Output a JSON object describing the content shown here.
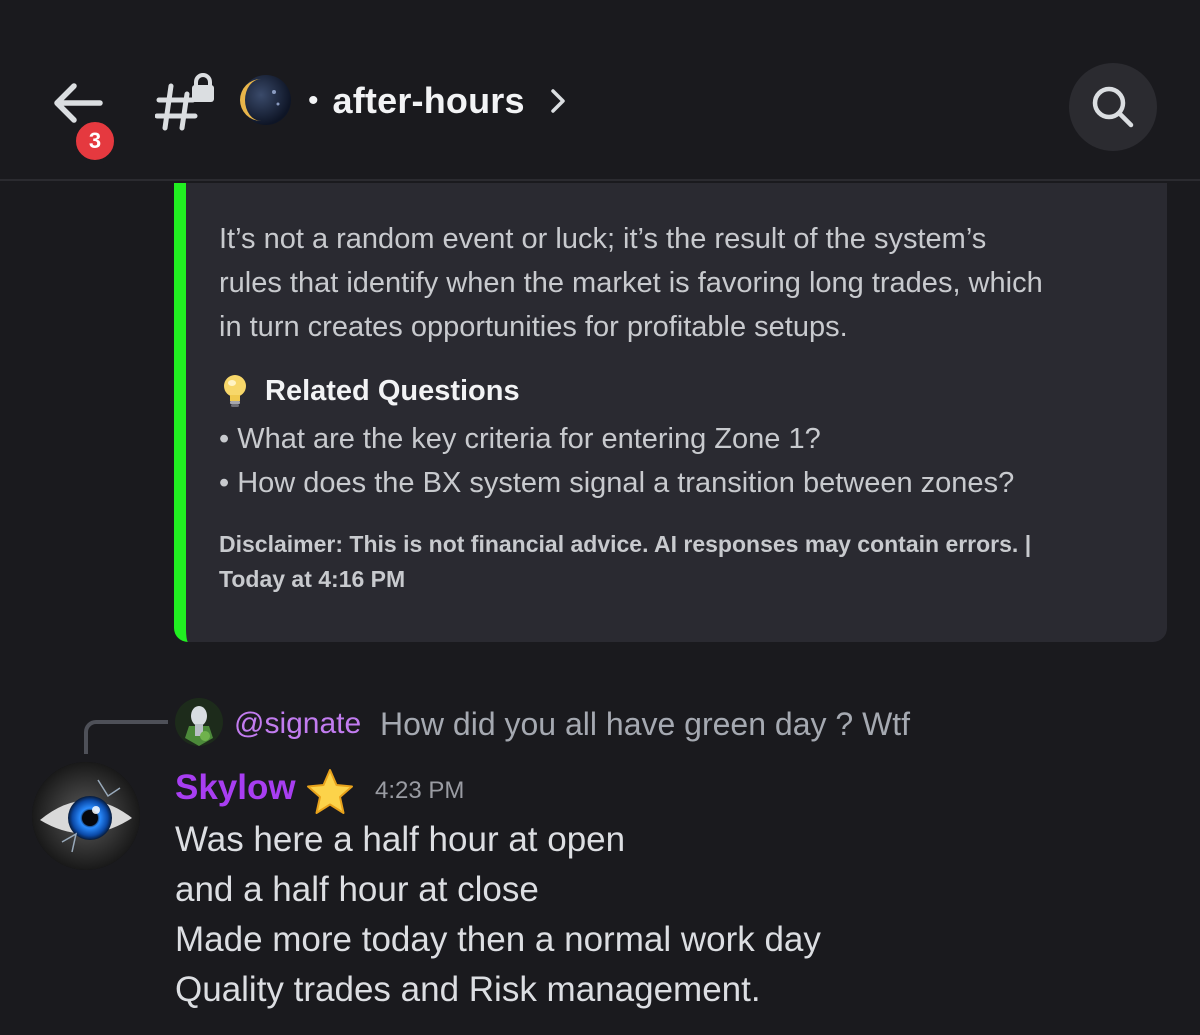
{
  "header": {
    "back_icon": "arrow-left-icon",
    "unread_count": "3",
    "channel_icon": "hashtag-lock-icon",
    "server_icon": "crescent-moon-icon",
    "separator": "•",
    "channel_name": "after-hours",
    "chevron_icon": "chevron-right-icon",
    "search_icon": "search-icon",
    "accent_color": "#e5393f"
  },
  "embed": {
    "accent_color": "#21ef21",
    "paragraph": [
      "It’s not a random event or luck; it’s the result of the system’s",
      "rules that identify when the market is favoring long trades, which",
      "in turn creates opportunities for profitable setups."
    ],
    "related_icon": "lightbulb-icon",
    "related_heading": "Related Questions",
    "related_questions": [
      "• What are the key criteria for entering Zone 1?",
      "• How does the BX system signal a transition between zones?"
    ],
    "disclaimer_line1": "Disclaimer: This is not financial advice. AI responses may contain errors. |",
    "disclaimer_line2": "Today at 4:16 PM"
  },
  "reply": {
    "author": "@signate",
    "text": "How did you all have green day ? Wtf",
    "author_color": "#c27cf0"
  },
  "message": {
    "author": "Skylow",
    "author_color": "#a83ef2",
    "badge_icon": "star-icon",
    "timestamp": "4:23 PM",
    "lines": [
      "Was here a half hour at open",
      "and a half hour at close",
      "Made more today then a normal work day",
      "Quality trades and Risk management."
    ]
  }
}
